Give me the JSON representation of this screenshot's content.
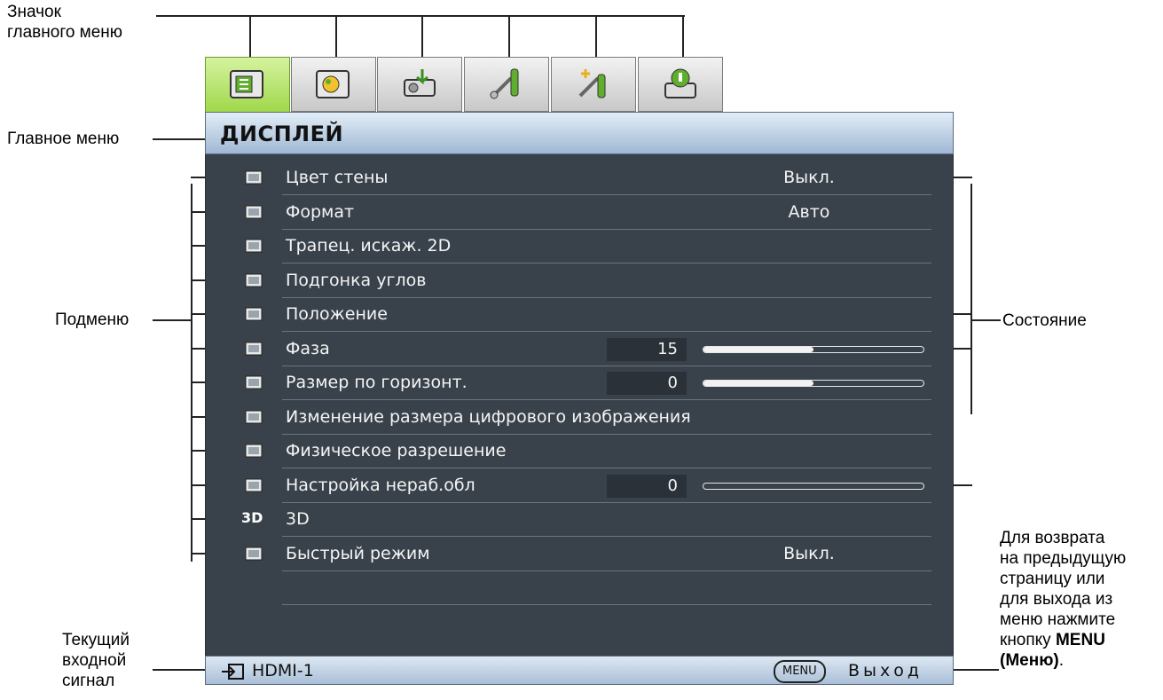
{
  "annotations": {
    "main_menu_icon": [
      "Значок",
      "главного меню"
    ],
    "main_menu": "Главное меню",
    "submenu": "Подменю",
    "status": "Состояние",
    "current_input": [
      "Текущий",
      "входной",
      "сигнал"
    ],
    "back_hint": [
      "Для возврата",
      "на предыдущую",
      "страницу или",
      "для выхода из",
      "меню нажмите",
      "кнопку ",
      "MENU",
      "(Меню)",
      "."
    ]
  },
  "tabs": [
    {
      "icon": "display-menu-icon",
      "active": true
    },
    {
      "icon": "picture-menu-icon",
      "active": false
    },
    {
      "icon": "source-menu-icon",
      "active": false
    },
    {
      "icon": "system-setup-basic-icon",
      "active": false
    },
    {
      "icon": "system-setup-advanced-icon",
      "active": false
    },
    {
      "icon": "information-icon",
      "active": false
    }
  ],
  "menu": {
    "title": "ДИСПЛЕЙ",
    "items": [
      {
        "label": "Цвет стены",
        "value": "Выкл.",
        "icon": "palette-icon"
      },
      {
        "label": "Формат",
        "value": "Авто",
        "icon": "aspect-ratio-icon"
      },
      {
        "label": "Трапец. искаж. 2D",
        "value": "",
        "icon": "keystone-icon"
      },
      {
        "label": "Подгонка углов",
        "value": "",
        "icon": "corner-fit-icon"
      },
      {
        "label": "Положение",
        "value": "",
        "icon": "position-icon"
      },
      {
        "label": "Фаза",
        "number": "15",
        "slider": 0.5,
        "icon": "phase-icon"
      },
      {
        "label": "Размер по горизонт.",
        "number": "0",
        "slider": 0.5,
        "icon": "h-size-icon"
      },
      {
        "label": "Изменение размера цифрового изображения",
        "value": "",
        "icon": "digital-zoom-icon"
      },
      {
        "label": "Физическое разрешение",
        "value": "",
        "icon": "native-resolution-icon"
      },
      {
        "label": "Настройка нераб.обл",
        "number": "0",
        "slider": 0.0,
        "icon": "overscan-icon"
      },
      {
        "label": "3D",
        "value": "",
        "icon": "3d-icon"
      },
      {
        "label": "Быстрый режим",
        "value": "Выкл.",
        "icon": "fast-mode-icon"
      }
    ]
  },
  "footer": {
    "source": "HDMI-1",
    "menu_key": "MENU",
    "exit": "Выход"
  },
  "colors": {
    "menu_body": "#39424b",
    "active_tab": "#9fd84a",
    "header": "#9fb8d4"
  }
}
